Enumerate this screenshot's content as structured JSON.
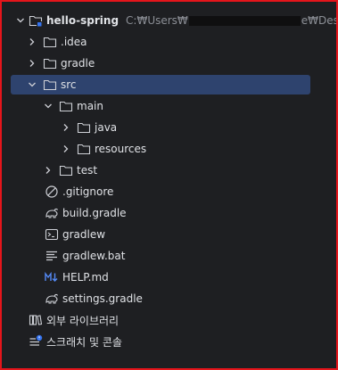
{
  "project": {
    "name": "hello-spring",
    "path_prefix": "C:₩Users₩",
    "path_suffix": "e₩Desktop₩deve"
  },
  "tree": {
    "idea": ".idea",
    "gradle": "gradle",
    "src": "src",
    "main": "main",
    "java": "java",
    "resources": "resources",
    "test": "test",
    "gitignore": ".gitignore",
    "build_gradle": "build.gradle",
    "gradlew": "gradlew",
    "gradlew_bat": "gradlew.bat",
    "help_md": "HELP.md",
    "settings_gradle": "settings.gradle"
  },
  "extra": {
    "external_libraries": "외부 라이브러리",
    "scratches": "스크래치 및 콘솔"
  },
  "icons": {
    "folder": "folder-icon",
    "module": "module-folder-icon",
    "gradle": "gradle-elephant-icon",
    "terminal": "terminal-script-icon",
    "text": "text-file-icon",
    "markdown": "markdown-icon",
    "ignore": "ignore-file-icon",
    "library": "library-icon",
    "scratch": "scratch-console-icon"
  },
  "colors": {
    "background": "#1e1f22",
    "selection": "#2e436e",
    "frame": "#e5151b",
    "text": "#dfe1e5",
    "muted": "#8c8f96",
    "markdown_blue": "#548af7"
  }
}
